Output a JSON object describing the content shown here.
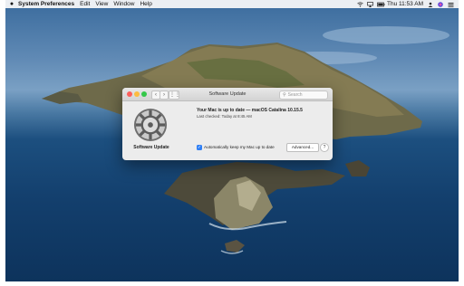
{
  "menubar": {
    "apple_icon": "apple-icon",
    "app_name": "System Preferences",
    "menus": [
      "Edit",
      "View",
      "Window",
      "Help"
    ],
    "clock": "Thu 11:53 AM",
    "status_icons": [
      "wifi-icon",
      "airplay-icon",
      "battery-icon",
      "user-icon",
      "siri-icon",
      "control-center-icon"
    ]
  },
  "window": {
    "title": "Software Update",
    "search_placeholder": "Search",
    "sidebar_label": "Software Update",
    "status_title": "Your Mac is up to date — macOS Catalina 10.15.5",
    "last_checked": "Last checked: Today at 8:45 AM",
    "auto_update_label": "Automatically keep my Mac up to date",
    "auto_update_checked": true,
    "advanced_button": "Advanced...",
    "help_button": "?"
  },
  "colors": {
    "close": "#fc605c",
    "minimize": "#fdbc40",
    "maximize": "#34c84a",
    "accent": "#2f7ff5"
  }
}
